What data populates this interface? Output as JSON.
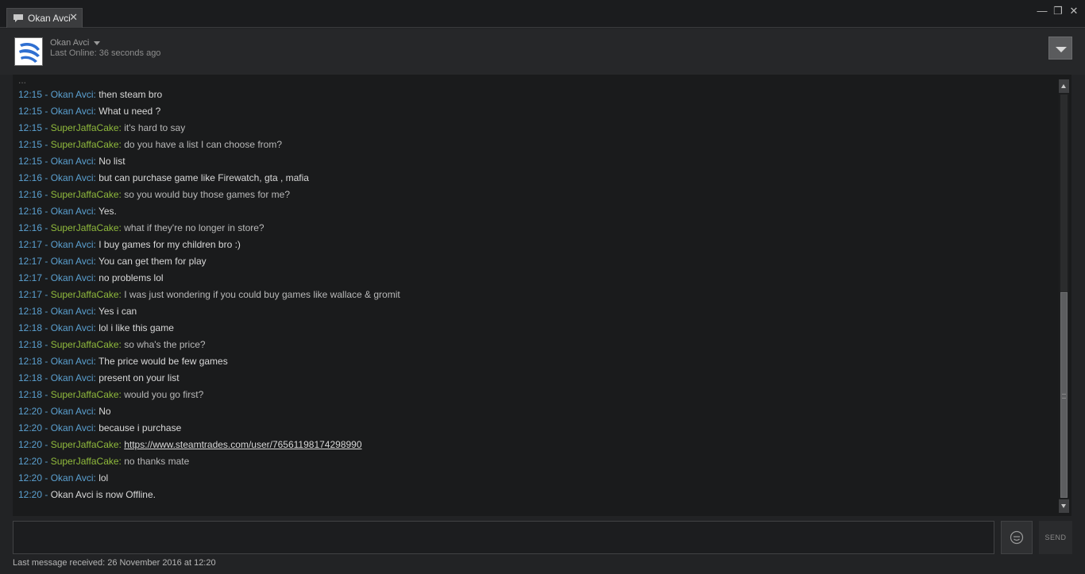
{
  "window": {
    "tab_title": "Okan Avci",
    "tab_close": "✕",
    "controls": {
      "minimize": "—",
      "restore": "❐",
      "close": "✕"
    }
  },
  "header": {
    "friend_name": "Okan Avci",
    "last_online": "Last Online: 36 seconds ago"
  },
  "chat": {
    "cut_line_text": "...",
    "messages": [
      {
        "time": "12:15",
        "author": "Okan Avci",
        "who": "okan",
        "text": "then steam bro"
      },
      {
        "time": "12:15",
        "author": "Okan Avci",
        "who": "okan",
        "text": "What u need ?"
      },
      {
        "time": "12:15",
        "author": "SuperJaffaCake",
        "who": "me",
        "text": "it's hard to say"
      },
      {
        "time": "12:15",
        "author": "SuperJaffaCake",
        "who": "me",
        "text": "do you have a list I can choose from?"
      },
      {
        "time": "12:15",
        "author": "Okan Avci",
        "who": "okan",
        "text": "No list"
      },
      {
        "time": "12:16",
        "author": "Okan Avci",
        "who": "okan",
        "text": "but can purchase game like Firewatch, gta , mafia"
      },
      {
        "time": "12:16",
        "author": "SuperJaffaCake",
        "who": "me",
        "text": "so you would buy those games for me?"
      },
      {
        "time": "12:16",
        "author": "Okan Avci",
        "who": "okan",
        "text": "Yes."
      },
      {
        "time": "12:16",
        "author": "SuperJaffaCake",
        "who": "me",
        "text": "what if they're no longer in store?"
      },
      {
        "time": "12:17",
        "author": "Okan Avci",
        "who": "okan",
        "text": "I buy games for my children bro :)"
      },
      {
        "time": "12:17",
        "author": "Okan Avci",
        "who": "okan",
        "text": "You can get them for play"
      },
      {
        "time": "12:17",
        "author": "Okan Avci",
        "who": "okan",
        "text": "no problems lol"
      },
      {
        "time": "12:17",
        "author": "SuperJaffaCake",
        "who": "me",
        "text": "I was just wondering if you could buy games like wallace & gromit"
      },
      {
        "time": "12:18",
        "author": "Okan Avci",
        "who": "okan",
        "text": "Yes i can"
      },
      {
        "time": "12:18",
        "author": "Okan Avci",
        "who": "okan",
        "text": "lol i like this game"
      },
      {
        "time": "12:18",
        "author": "SuperJaffaCake",
        "who": "me",
        "text": "so wha's the price?"
      },
      {
        "time": "12:18",
        "author": "Okan Avci",
        "who": "okan",
        "text": "The price would be few games"
      },
      {
        "time": "12:18",
        "author": "Okan Avci",
        "who": "okan",
        "text": "present on your list"
      },
      {
        "time": "12:18",
        "author": "SuperJaffaCake",
        "who": "me",
        "text": "would you go first?"
      },
      {
        "time": "12:20",
        "author": "Okan Avci",
        "who": "okan",
        "text": "No"
      },
      {
        "time": "12:20",
        "author": "Okan Avci",
        "who": "okan",
        "text": "because i purchase"
      },
      {
        "time": "12:20",
        "author": "SuperJaffaCake",
        "who": "me",
        "text": "https://www.steamtrades.com/user/76561198174298990",
        "link": true
      },
      {
        "time": "12:20",
        "author": "SuperJaffaCake",
        "who": "me",
        "text": "no thanks mate"
      },
      {
        "time": "12:20",
        "author": "Okan Avci",
        "who": "okan",
        "text": "lol"
      }
    ],
    "system_message": {
      "time": "12:20",
      "text": "Okan Avci is now Offline."
    }
  },
  "scrollbar": {
    "position_fraction": 0.52
  },
  "input": {
    "placeholder": "",
    "send_label": "SEND"
  },
  "status": {
    "last_message": "Last message received: 26 November 2016 at 12:20"
  },
  "colors": {
    "okan_name": "#5ba0d0",
    "me_name": "#90ba3c",
    "time": "#5ba0d0",
    "text": "#d8d8d8",
    "background": "#1a1b1c"
  },
  "icons": {
    "tab": "chat-bubble-icon",
    "emoji": "smiley-icon",
    "menu": "dropdown-arrow-icon"
  }
}
